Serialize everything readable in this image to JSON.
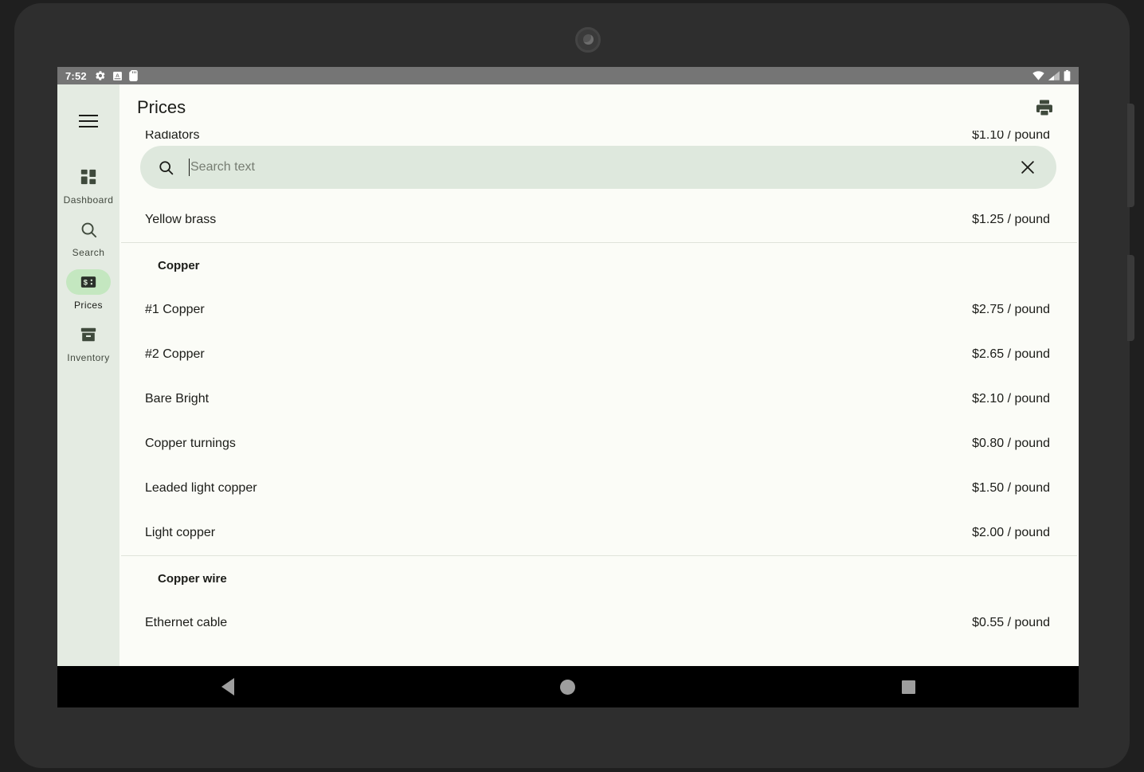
{
  "status_bar": {
    "time": "7:52",
    "left_icons": [
      "settings-gear-icon",
      "android-a-icon",
      "sd-card-icon"
    ],
    "right_icons": [
      "wifi-icon",
      "cellular-signal-icon",
      "battery-icon"
    ]
  },
  "app_bar": {
    "title": "Prices",
    "menu_icon": "hamburger-menu-icon",
    "print_icon": "print-icon"
  },
  "sidebar": {
    "items": [
      {
        "label": "Dashboard",
        "icon": "dashboard-grid-icon",
        "selected": false
      },
      {
        "label": "Search",
        "icon": "search-magnifier-icon",
        "selected": false
      },
      {
        "label": "Prices",
        "icon": "price-tag-money-icon",
        "selected": true
      },
      {
        "label": "Inventory",
        "icon": "archive-box-icon",
        "selected": false
      }
    ]
  },
  "search": {
    "placeholder": "Search text",
    "value": "",
    "search_icon": "search-magnifier-icon",
    "clear_icon": "close-x-icon"
  },
  "list": {
    "obscured_top_row": {
      "label": "Radiators",
      "price": "$1.10 / pound"
    },
    "rows": [
      {
        "type": "item",
        "label": "Yellow brass",
        "price": "$1.25 / pound"
      },
      {
        "type": "divider"
      },
      {
        "type": "section",
        "label": "Copper"
      },
      {
        "type": "item",
        "label": "#1 Copper",
        "price": "$2.75 / pound"
      },
      {
        "type": "item",
        "label": "#2 Copper",
        "price": "$2.65 / pound"
      },
      {
        "type": "item",
        "label": "Bare Bright",
        "price": "$2.10 / pound"
      },
      {
        "type": "item",
        "label": "Copper turnings",
        "price": "$0.80 / pound"
      },
      {
        "type": "item",
        "label": "Leaded light copper",
        "price": "$1.50 / pound"
      },
      {
        "type": "item",
        "label": "Light copper",
        "price": "$2.00 / pound"
      },
      {
        "type": "divider"
      },
      {
        "type": "section",
        "label": "Copper wire"
      },
      {
        "type": "item",
        "label": "Ethernet cable",
        "price": "$0.55 / pound"
      }
    ]
  },
  "android_nav": {
    "back_label": "Back",
    "home_label": "Home",
    "recents_label": "Recents"
  },
  "colors": {
    "sidebar_bg": "#e4ebe2",
    "content_bg": "#fbfcf7",
    "selected_pill": "#c4e7c0",
    "search_bg": "#dee8dd",
    "accent_dark": "#3f4a3c",
    "status_bar_bg": "#757575"
  }
}
